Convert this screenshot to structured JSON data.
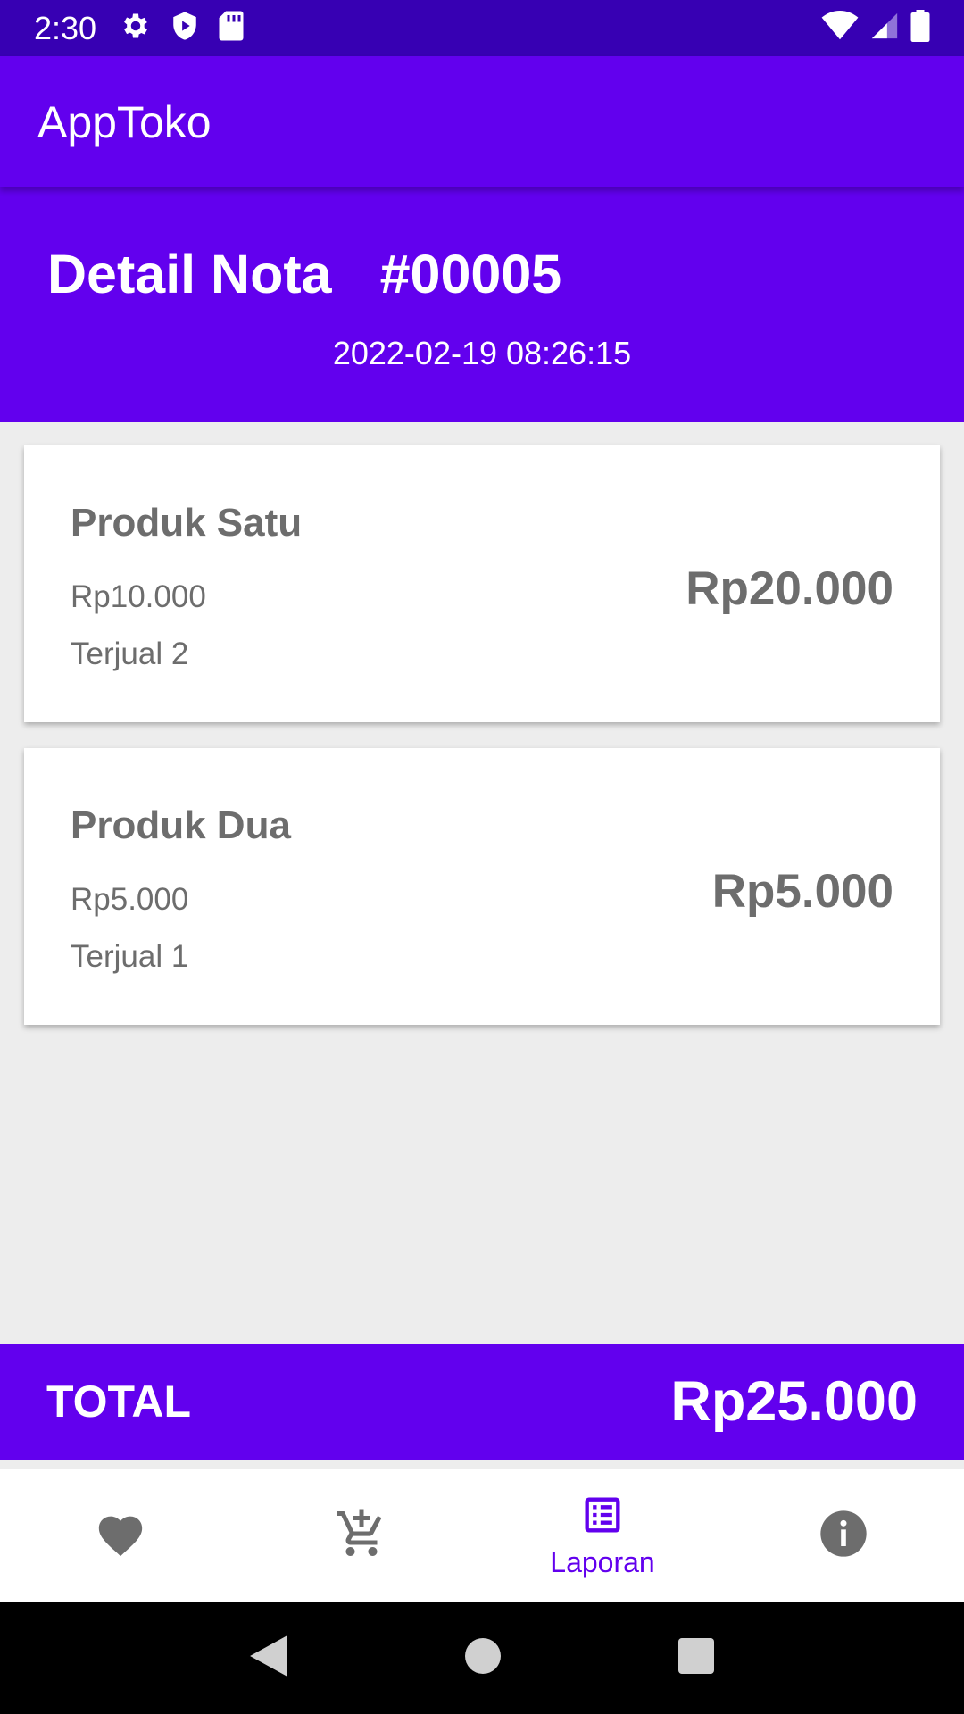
{
  "status_bar": {
    "time": "2:30",
    "left_icons": [
      "settings-icon",
      "shield-icon",
      "sd-card-icon"
    ],
    "right_icons": [
      "wifi-icon",
      "signal-icon",
      "battery-icon"
    ],
    "bg_color": "#3700b3"
  },
  "app_bar": {
    "title": "AppToko",
    "bg_color": "#6200ee"
  },
  "nota": {
    "label": "Detail Nota",
    "number": "#00005",
    "datetime": "2022-02-19 08:26:15"
  },
  "items": [
    {
      "name": "Produk Satu",
      "price": "Rp10.000",
      "sold": "Terjual 2",
      "subtotal": "Rp20.000"
    },
    {
      "name": "Produk Dua",
      "price": "Rp5.000",
      "sold": "Terjual 1",
      "subtotal": "Rp5.000"
    }
  ],
  "total": {
    "label": "TOTAL",
    "value": "Rp25.000"
  },
  "bottom_nav": {
    "items": [
      {
        "icon": "heart-icon",
        "label": ""
      },
      {
        "icon": "add-cart-icon",
        "label": ""
      },
      {
        "icon": "report-list-icon",
        "label": "Laporan",
        "active": true
      },
      {
        "icon": "info-icon",
        "label": ""
      }
    ],
    "active_color": "#6200ee",
    "inactive_color": "#6d6d6d"
  },
  "system_nav": {
    "buttons": [
      "back-icon",
      "home-icon",
      "recents-icon"
    ]
  }
}
